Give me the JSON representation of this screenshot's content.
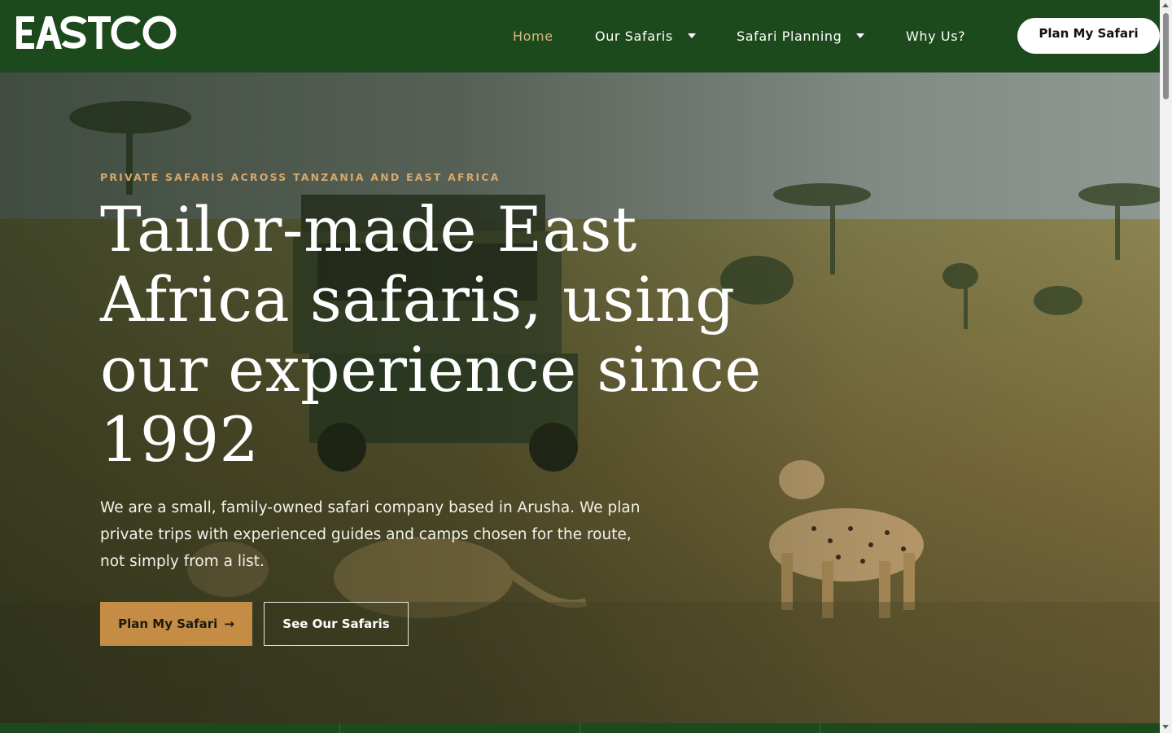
{
  "brand": {
    "logo_text": "EASTCO"
  },
  "nav": {
    "items": [
      {
        "label": "Home",
        "active": true,
        "has_dropdown": false
      },
      {
        "label": "Our Safaris",
        "active": false,
        "has_dropdown": true
      },
      {
        "label": "Safari Planning",
        "active": false,
        "has_dropdown": true
      },
      {
        "label": "Why Us?",
        "active": false,
        "has_dropdown": false
      }
    ],
    "cta_label": "Plan My Safari"
  },
  "hero": {
    "eyebrow": "PRIVATE SAFARIS ACROSS TANZANIA AND EAST AFRICA",
    "headline": "Tailor-made East Africa safaris, using our experience since 1992",
    "lede": "We are a small, family-owned safari company based in Arusha. We plan private trips with experienced guides and camps chosen for the route, not simply from a list.",
    "primary_button": "Plan My Safari",
    "primary_button_arrow": "→",
    "secondary_button": "See Our Safaris",
    "image_subject": "safari vehicle with cheetahs on savanna grassland"
  },
  "colors": {
    "header_bg": "#1d4a1c",
    "accent_gold": "#c58c45",
    "eyebrow": "#d8a86a",
    "nav_active": "#d8b880"
  },
  "icons": {
    "dropdown": "chevron-down-icon",
    "arrow": "arrow-right-icon"
  }
}
